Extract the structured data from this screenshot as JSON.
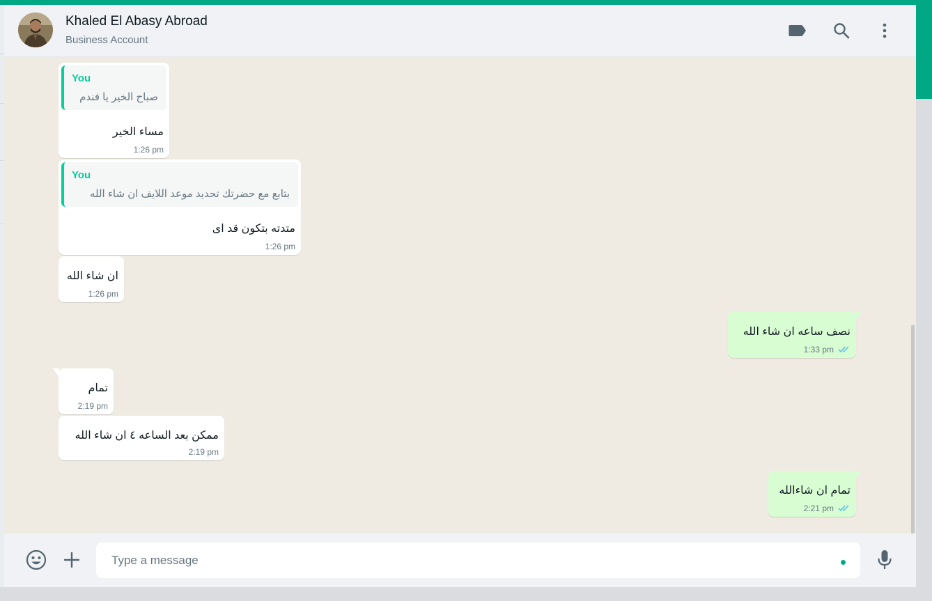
{
  "header": {
    "contact_name": "Khaled El Abasy Abroad",
    "contact_subtitle": "Business Account",
    "icons": [
      "label-icon",
      "search-icon",
      "menu-icon"
    ]
  },
  "messages": [
    {
      "direction": "incoming",
      "quote": {
        "author": "You",
        "text": "صباح الخير يا فندم"
      },
      "text": "مساء الخير",
      "time": "1:26 pm"
    },
    {
      "direction": "incoming",
      "quote": {
        "author": "You",
        "text": "بتابع مع حضرتك تحديد موعد اللايف ان شاء الله"
      },
      "text": "متدته بتكون قد اى",
      "time": "1:26 pm"
    },
    {
      "direction": "incoming",
      "text": "ان شاء الله",
      "time": "1:26 pm"
    },
    {
      "direction": "outgoing",
      "text": "نصف ساعه ان شاء الله",
      "time": "1:33 pm",
      "status": "read"
    },
    {
      "direction": "incoming",
      "text": "تمام",
      "time": "2:19 pm"
    },
    {
      "direction": "incoming",
      "text": "ممكن بعد الساعه ٤ ان شاء الله",
      "time": "2:19 pm"
    },
    {
      "direction": "outgoing",
      "text": "تمام ان شاءالله",
      "time": "2:21 pm",
      "status": "read"
    }
  ],
  "composer": {
    "placeholder": "Type a message",
    "icons": [
      "emoji-icon",
      "attach-plus-icon",
      "microphone-icon"
    ]
  },
  "colors": {
    "accent": "#00a884",
    "header_bg": "#f0f2f5",
    "chat_bg": "#efeae2",
    "incoming_bubble": "#ffffff",
    "outgoing_bubble": "#d9fdd3",
    "quote_bar": "#06cf9c",
    "read_ticks": "#53bdeb"
  }
}
